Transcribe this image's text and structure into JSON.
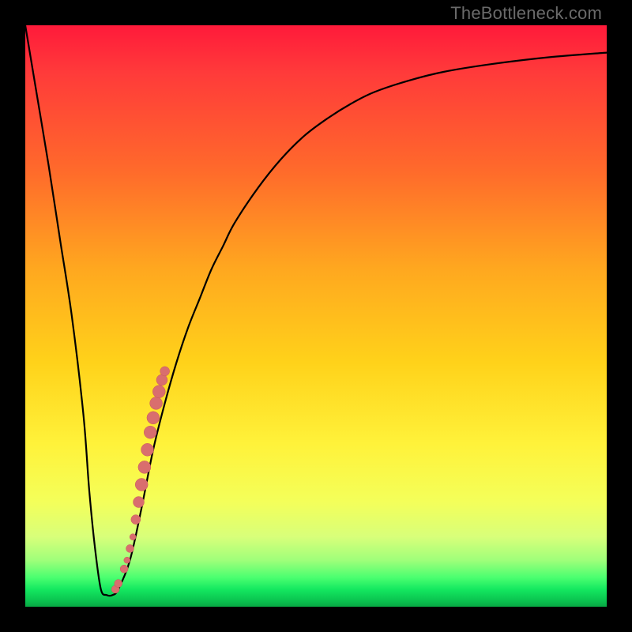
{
  "watermark": "TheBottleneck.com",
  "colors": {
    "curve": "#000000",
    "dots": "#d96e6e",
    "dot_stroke": "#c85a5a"
  },
  "chart_data": {
    "type": "line",
    "title": "",
    "xlabel": "",
    "ylabel": "",
    "xlim": [
      0,
      100
    ],
    "ylim": [
      0,
      100
    ],
    "series": [
      {
        "name": "bottleneck-curve",
        "x": [
          0,
          2,
          4,
          6,
          8,
          10,
          11,
          12,
          13,
          14,
          15,
          16,
          18,
          20,
          22,
          24,
          26,
          28,
          30,
          32,
          34,
          36,
          40,
          44,
          48,
          52,
          56,
          60,
          66,
          72,
          80,
          90,
          100
        ],
        "y": [
          100,
          88,
          76,
          63,
          50,
          33,
          20,
          10,
          3,
          2,
          2,
          3,
          8,
          17,
          27,
          35,
          42,
          48,
          53,
          58,
          62,
          66,
          72,
          77,
          81,
          84,
          86.5,
          88.5,
          90.5,
          92,
          93.3,
          94.5,
          95.3
        ]
      }
    ],
    "highlight_points": {
      "name": "highlighted-segment",
      "x": [
        15.5,
        16.0,
        17.0,
        17.5,
        18.0,
        18.5,
        19.0,
        19.5,
        20.0,
        20.5,
        21.0,
        21.5,
        22.0,
        22.5,
        23.0,
        23.5,
        24.0
      ],
      "y": [
        3.0,
        4.0,
        6.5,
        8.0,
        10.0,
        12.0,
        15.0,
        18.0,
        21.0,
        24.0,
        27.0,
        30.0,
        32.5,
        35.0,
        37.0,
        39.0,
        40.5
      ],
      "r": [
        5,
        5,
        5,
        4,
        5,
        4,
        6,
        7,
        8,
        8,
        8,
        8,
        8,
        8,
        8,
        7,
        6
      ]
    }
  }
}
